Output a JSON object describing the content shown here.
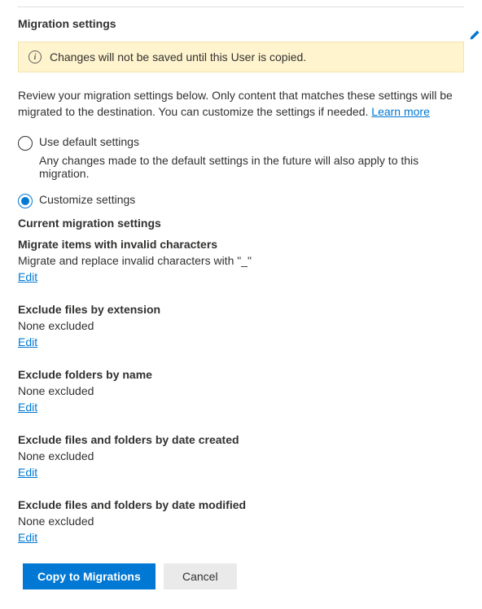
{
  "header": {
    "title": "Migration settings"
  },
  "banner": {
    "text": "Changes will not be saved until this User is copied."
  },
  "review": {
    "text": "Review your migration settings below. Only content that matches these settings will be migrated to the destination. You can customize the settings if needed. ",
    "link": "Learn more"
  },
  "radios": {
    "default": {
      "label": "Use default settings",
      "desc": "Any changes made to the default settings in the future will also apply to this migration."
    },
    "custom": {
      "label": "Customize settings"
    }
  },
  "current_heading": "Current migration settings",
  "settings": {
    "invalid": {
      "title": "Migrate items with invalid characters",
      "value": "Migrate and replace invalid characters with \"_\"",
      "edit": "Edit"
    },
    "ext": {
      "title": "Exclude files by extension",
      "value": "None excluded",
      "edit": "Edit"
    },
    "folders": {
      "title": "Exclude folders by name",
      "value": "None excluded",
      "edit": "Edit"
    },
    "created": {
      "title": "Exclude files and folders by date created",
      "value": "None excluded",
      "edit": "Edit"
    },
    "modified": {
      "title": "Exclude files and folders by date modified",
      "value": "None excluded",
      "edit": "Edit"
    }
  },
  "footer": {
    "primary": "Copy to Migrations",
    "secondary": "Cancel"
  }
}
